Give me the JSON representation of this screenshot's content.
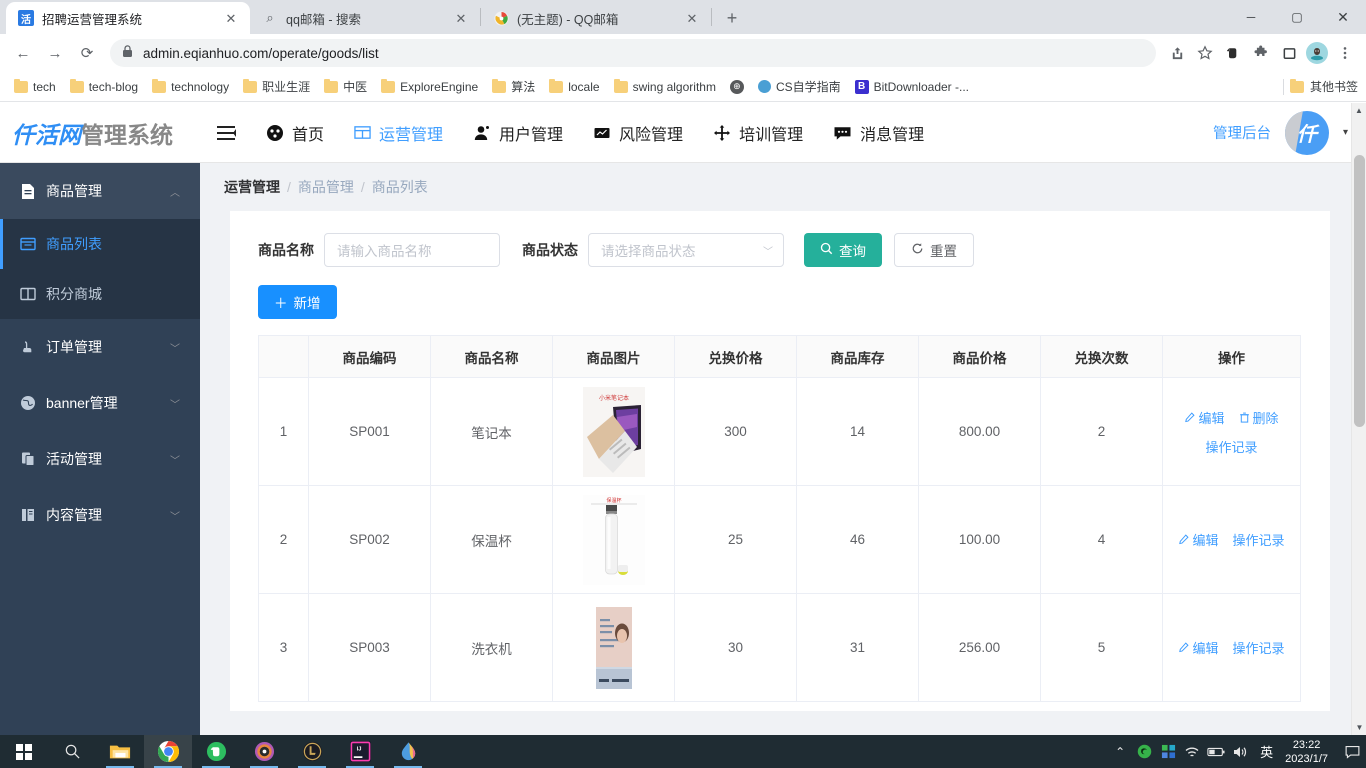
{
  "browser": {
    "tabs": [
      {
        "title": "招聘运营管理系统",
        "favicon": "huo-icon",
        "active": true
      },
      {
        "title": "qq邮箱 - 搜索",
        "favicon": "search-icon",
        "active": false
      },
      {
        "title": "(无主题) - QQ邮箱",
        "favicon": "qqmail-icon",
        "active": false
      }
    ],
    "newtab_label": "+",
    "window_controls": {
      "minimize": "─",
      "maximize": "▢",
      "close": "✕"
    },
    "nav": {
      "back": "←",
      "forward": "→",
      "reload": "⟳"
    },
    "omnibox": {
      "lock": "🔒",
      "url": "admin.eqianhuo.com/operate/goods/list",
      "share": "⇪",
      "star": "☆"
    },
    "extensions": [
      "evernote-icon",
      "puzzle-icon",
      "sidepanel-icon",
      "profile-avatar",
      "chrome-menu"
    ],
    "bookmarks": [
      {
        "label": "tech",
        "icon": "folder-icon"
      },
      {
        "label": "tech-blog",
        "icon": "folder-icon"
      },
      {
        "label": "technology",
        "icon": "folder-icon"
      },
      {
        "label": "职业生涯",
        "icon": "folder-icon"
      },
      {
        "label": "中医",
        "icon": "folder-icon"
      },
      {
        "label": "ExploreEngine",
        "icon": "folder-icon"
      },
      {
        "label": "算法",
        "icon": "folder-icon"
      },
      {
        "label": "locale",
        "icon": "folder-icon"
      },
      {
        "label": "swing algorithm",
        "icon": "folder-icon"
      },
      {
        "label": "",
        "icon": "globe-icon"
      },
      {
        "label": "CS自学指南",
        "icon": "ball-icon"
      },
      {
        "label": "BitDownloader -...",
        "icon": "b-icon"
      }
    ],
    "other_bookmarks": "其他书签"
  },
  "app": {
    "logo": {
      "brand": "仟活网",
      "suffix": "管理系统"
    },
    "hamburger": "☰",
    "nav": [
      {
        "label": "首页",
        "icon": "dashboard-icon",
        "active": false
      },
      {
        "label": "运营管理",
        "icon": "table-icon",
        "active": true
      },
      {
        "label": "用户管理",
        "icon": "user-icon",
        "active": false
      },
      {
        "label": "风险管理",
        "icon": "chart-icon",
        "active": false
      },
      {
        "label": "培训管理",
        "icon": "move-icon",
        "active": false
      },
      {
        "label": "消息管理",
        "icon": "message-icon",
        "active": false
      }
    ],
    "admin_link": "管理后台",
    "avatar_text": "仟",
    "caret": "▾"
  },
  "sidebar": {
    "group": {
      "label": "商品管理",
      "icon": "document-icon",
      "arrow": "︿"
    },
    "sub_items": [
      {
        "label": "商品列表",
        "icon": "list-icon",
        "selected": true
      },
      {
        "label": "积分商城",
        "icon": "book-icon",
        "selected": false
      }
    ],
    "items": [
      {
        "label": "订单管理",
        "icon": "order-icon",
        "arrow": "﹀"
      },
      {
        "label": "banner管理",
        "icon": "globe-icon",
        "arrow": "﹀"
      },
      {
        "label": "活动管理",
        "icon": "copy-icon",
        "arrow": "﹀"
      },
      {
        "label": "内容管理",
        "icon": "content-icon",
        "arrow": "﹀"
      }
    ]
  },
  "breadcrumb": {
    "first": "运营管理",
    "sep": "/",
    "second": "商品管理",
    "third": "商品列表"
  },
  "filters": {
    "name_label": "商品名称",
    "name_placeholder": "请输入商品名称",
    "name_value": "",
    "status_label": "商品状态",
    "status_placeholder": "请选择商品状态",
    "status_value": "",
    "status_arrow": "﹀",
    "search_button": "查询",
    "search_icon": "search-icon",
    "reset_button": "重置",
    "reset_icon": "refresh-icon",
    "add_button": "新增",
    "add_icon": "plus-icon"
  },
  "table": {
    "columns": [
      "",
      "商品编码",
      "商品名称",
      "商品图片",
      "兑换价格",
      "商品库存",
      "商品价格",
      "兑换次数",
      "操作"
    ],
    "rows": [
      {
        "index": "1",
        "code": "SP001",
        "name": "笔记本",
        "image": "laptop-thumbnail",
        "exchange_price": "300",
        "stock": "14",
        "price": "800.00",
        "exchange_count": "2",
        "actions": [
          "编辑",
          "删除",
          "操作记录"
        ]
      },
      {
        "index": "2",
        "code": "SP002",
        "name": "保温杯",
        "image": "thermos-thumbnail",
        "exchange_price": "25",
        "stock": "46",
        "price": "100.00",
        "exchange_count": "4",
        "actions": [
          "编辑",
          "操作记录"
        ]
      },
      {
        "index": "3",
        "code": "SP003",
        "name": "洗衣机",
        "image": "idcard-thumbnail",
        "exchange_price": "30",
        "stock": "31",
        "price": "256.00",
        "exchange_count": "5",
        "actions": [
          "编辑",
          "操作记录"
        ]
      }
    ]
  },
  "taskbar": {
    "items": [
      "start-icon",
      "search-icon",
      "file-explorer-icon",
      "chrome-icon",
      "evernote-icon",
      "purple-disc-icon",
      "lol-icon",
      "intellij-icon",
      "paint-drop-icon"
    ],
    "tray": [
      "chevron-up-icon",
      "nvidia-icon",
      "apps-icon",
      "wifi-icon",
      "battery-icon",
      "volume-icon"
    ],
    "language": "英",
    "time": "23:22",
    "date": "2023/1/7",
    "notification": "notification-icon"
  },
  "colors": {
    "accent_blue": "#409eff",
    "primary_blue": "#1890ff",
    "teal": "#25b09b",
    "sidebar_bg": "#304156",
    "sidebar_sub_bg": "#263445",
    "content_bg": "#f0f2f5"
  }
}
